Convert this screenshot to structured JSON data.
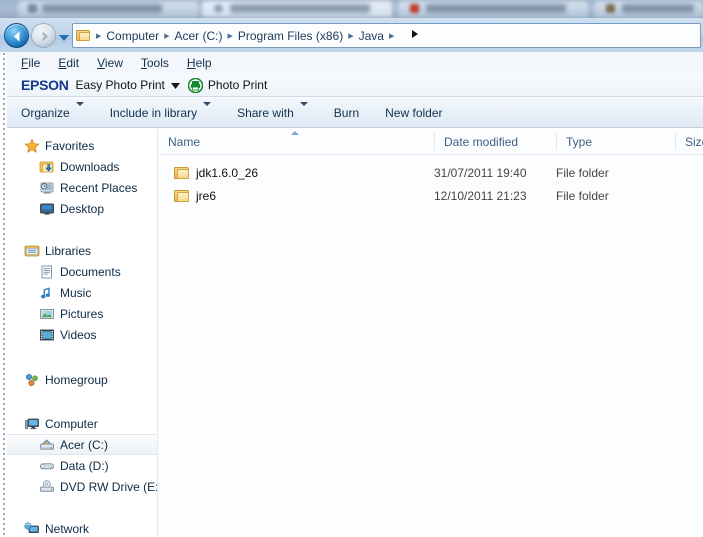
{
  "window": {
    "title": "Java",
    "background_tabs": [
      "TinyPic - Free Image Host",
      "Learn Tutorial: The Basics",
      "Java vs C# - Google Sear",
      "Program Files"
    ]
  },
  "navigation": {
    "back_label": "Back",
    "forward_label": "Forward",
    "recent_pages_label": "Recent pages",
    "breadcrumb_icon": "folder-icon",
    "breadcrumbs": [
      "Computer",
      "Acer (C:)",
      "Program Files (x86)",
      "Java"
    ]
  },
  "menubar": {
    "items": [
      {
        "label": "File",
        "accel": "F",
        "rest": "ile"
      },
      {
        "label": "Edit",
        "accel": "E",
        "rest": "dit"
      },
      {
        "label": "View",
        "accel": "V",
        "rest": "iew"
      },
      {
        "label": "Tools",
        "accel": "T",
        "rest": "ools"
      },
      {
        "label": "Help",
        "accel": "H",
        "rest": "elp"
      }
    ]
  },
  "epson_toolbar": {
    "brand": "EPSON",
    "easy_photo_print": "Easy Photo Print",
    "dropdown_icon": "chevron-down-icon",
    "photo_print_icon": "printer-icon",
    "photo_print": "Photo Print"
  },
  "commandbar": {
    "items": [
      {
        "label": "Organize",
        "has_caret": true
      },
      {
        "label": "Include in library",
        "has_caret": true
      },
      {
        "label": "Share with",
        "has_caret": true
      },
      {
        "label": "Burn",
        "has_caret": false
      },
      {
        "label": "New folder",
        "has_caret": false
      }
    ]
  },
  "sidebar": {
    "groups": [
      {
        "root": {
          "label": "Favorites",
          "icon": "star-icon"
        },
        "children": [
          {
            "label": "Downloads",
            "icon": "downloads-folder-icon"
          },
          {
            "label": "Recent Places",
            "icon": "recent-places-icon"
          },
          {
            "label": "Desktop",
            "icon": "desktop-icon"
          }
        ]
      },
      {
        "root": {
          "label": "Libraries",
          "icon": "libraries-icon"
        },
        "children": [
          {
            "label": "Documents",
            "icon": "documents-icon"
          },
          {
            "label": "Music",
            "icon": "music-icon"
          },
          {
            "label": "Pictures",
            "icon": "pictures-icon"
          },
          {
            "label": "Videos",
            "icon": "videos-icon"
          }
        ]
      },
      {
        "root": {
          "label": "Homegroup",
          "icon": "homegroup-icon"
        },
        "children": []
      },
      {
        "root": {
          "label": "Computer",
          "icon": "computer-icon"
        },
        "children": [
          {
            "label": "Acer (C:)",
            "icon": "hard-drive-icon",
            "selected": true
          },
          {
            "label": "Data (D:)",
            "icon": "drive-icon",
            "selected": false
          },
          {
            "label": "DVD RW Drive (E:) E",
            "icon": "dvd-drive-icon",
            "selected": false
          }
        ]
      },
      {
        "root": {
          "label": "Network",
          "icon": "network-icon"
        },
        "children": []
      }
    ]
  },
  "filepane": {
    "columns": [
      {
        "label": "Name",
        "sorted": "asc"
      },
      {
        "label": "Date modified",
        "sorted": ""
      },
      {
        "label": "Type",
        "sorted": ""
      },
      {
        "label": "Size",
        "sorted": ""
      }
    ],
    "rows": [
      {
        "icon": "folder-icon",
        "name": "jdk1.6.0_26",
        "date_modified": "31/07/2011 19:40",
        "type": "File folder",
        "size": ""
      },
      {
        "icon": "folder-icon",
        "name": "jre6",
        "date_modified": "12/10/2011 21:23",
        "type": "File folder",
        "size": ""
      }
    ]
  },
  "colors": {
    "chrome_blue": "#bfd4ea",
    "epson_blue": "#14378f",
    "header_text": "#3b5f86",
    "folder_yellow": "#e8b94e",
    "selection": "#eef2f6"
  }
}
